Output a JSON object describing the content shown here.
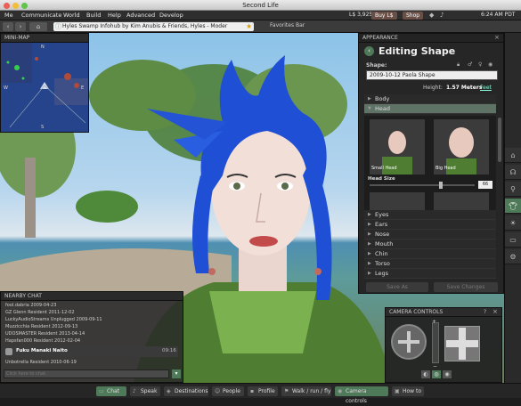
{
  "window": {
    "title": "Second Life"
  },
  "menubar": {
    "items": [
      "Me",
      "Communicate",
      "World",
      "Build",
      "Help",
      "Advanced",
      "Develop"
    ],
    "balance": "L$ 3,925",
    "buy": "Buy L$",
    "shop": "Shop",
    "time": "6:24 AM PDT"
  },
  "navbar": {
    "location": "Hyles Swamp Infohub by Kim Anubis & Friends, Hyles - Moder",
    "favorites": "Favorites Bar"
  },
  "minimap": {
    "title": "MINI-MAP",
    "markers": [
      "N",
      "W",
      "E",
      "S"
    ]
  },
  "appearance": {
    "panel_title": "APPEARANCE",
    "heading": "Editing Shape",
    "shape_label": "Shape:",
    "shape_name": "2009-10-12 Paola Shape",
    "height_label": "Height: ",
    "height_value": "1.57 Meters",
    "height_unit": "Feet",
    "slots_top": [
      "Body",
      "Head"
    ],
    "thumb_labels": [
      "Small Head",
      "Big Head"
    ],
    "head_size_label": "Head Size",
    "head_size_value": "66",
    "slots_bottom": [
      "Eyes",
      "Ears",
      "Nose",
      "Mouth",
      "Chin",
      "Torso",
      "Legs"
    ],
    "save_as": "Save As",
    "save_changes": "Save Changes"
  },
  "chat": {
    "title": "NEARBY CHAT",
    "lines": [
      "fool.dabria 2009-04-23",
      "GZ Glenn Resident 2011-12-02",
      "LuckyAudioStreams Unplugged 2009-09-11",
      "Muzzicchia Resident 2012-09-13",
      "UDOSMASTER Resident 2013-04-14",
      "Hapsfan000 Resident 2012-02-04"
    ],
    "speaker_name": "Fuku Manaki Naito",
    "speaker_time": "09:16",
    "speaker_line": "Unbotrella Resident 2010-06-19",
    "input_placeholder": "Click here to chat."
  },
  "camera": {
    "title": "CAMERA CONTROLS"
  },
  "sidebar_icons": [
    "home-icon",
    "headset-icon",
    "search-icon",
    "shirt-icon",
    "lightbulb-icon",
    "display-icon",
    "gear-icon"
  ],
  "bottombar": {
    "buttons": [
      "Chat",
      "Speak",
      "Destinations",
      "People",
      "Profile",
      "Walk / run / fly",
      "Camera controls",
      "How to"
    ]
  },
  "colors": {
    "accent_green": "#4e7a5a",
    "selected_row": "#5e7266",
    "pill_brown": "#6a4f46"
  }
}
